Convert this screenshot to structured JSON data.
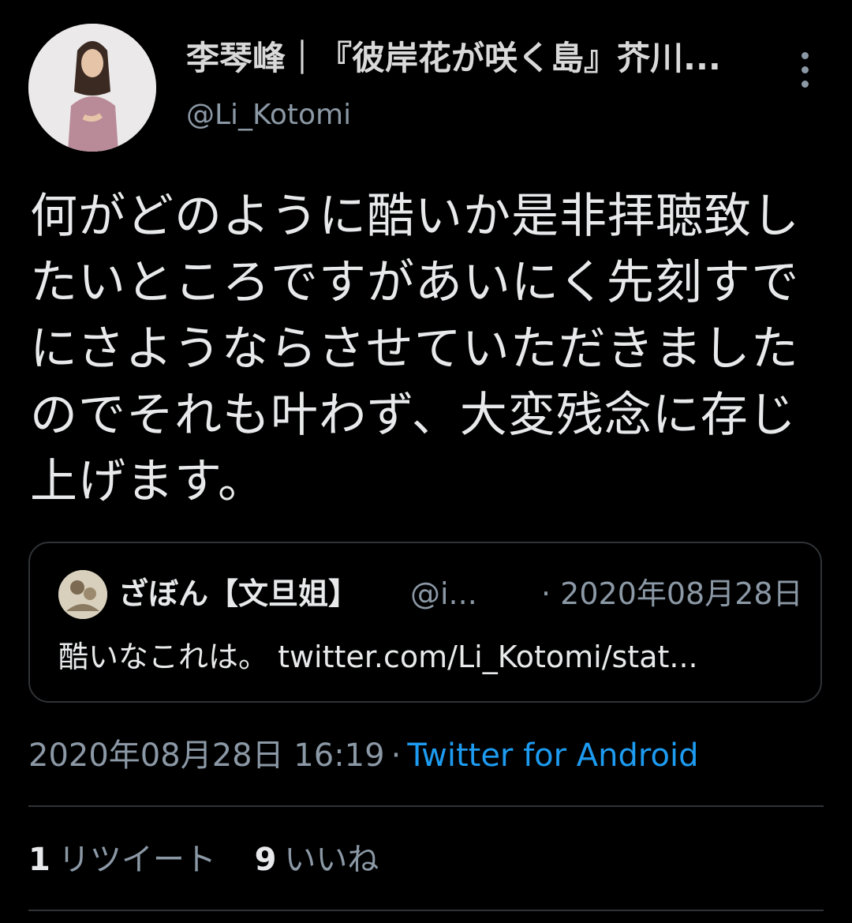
{
  "author": {
    "display_name": "李琴峰｜『彼岸花が咲く島』芥川...",
    "handle": "@Li_Kotomi"
  },
  "tweet": {
    "text": "何がどのように酷いか是非拝聴致したいところですがあいにく先刻すでにさようならさせていただきましたのでそれも叶わず、大変残念に存じ上げます。",
    "timestamp": "2020年08月28日 16:19",
    "separator": "·",
    "source": "Twitter for Android"
  },
  "quote": {
    "display_name": "ざぼん【文旦姐】",
    "handle": "@i...",
    "date": "· 2020年08月28日",
    "text": "酷いなこれは。 twitter.com/Li_Kotomi/stat..."
  },
  "stats": {
    "retweets_count": "1",
    "retweets_label": "リツイート",
    "likes_count": "9",
    "likes_label": "いいね"
  },
  "colors": {
    "background": "#000000",
    "text": "#e7e9ea",
    "secondary": "#8b98a5",
    "link": "#1d9bf0",
    "border": "#2f3336"
  },
  "icons": [
    "more-vertical-icon"
  ]
}
